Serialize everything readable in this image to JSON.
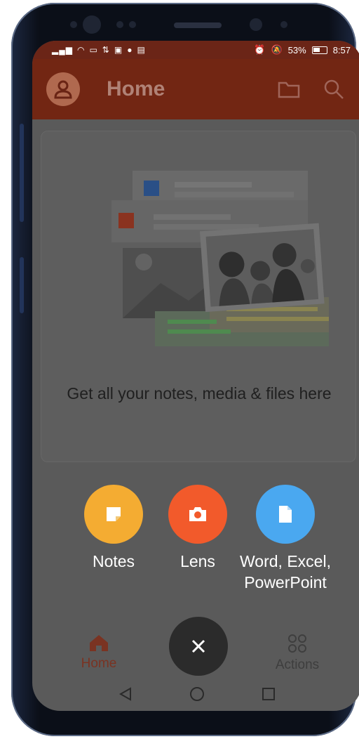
{
  "status_bar": {
    "left_icons": [
      "signal-icon",
      "wifi-icon",
      "cast-icon",
      "sync-icon",
      "linkedin-icon",
      "chat-icon",
      "news-icon"
    ],
    "alarm_icon": "alarm-icon",
    "mute_icon": "bell-off-icon",
    "battery": "53%",
    "time": "8:57"
  },
  "app_bar": {
    "title": "Home",
    "avatar_icon": "person-icon",
    "folder_icon": "folder-icon",
    "search_icon": "search-icon"
  },
  "card": {
    "message": "Get all your notes, media & files here",
    "illustration_icons": [
      "word-doc-icon",
      "powerpoint-doc-icon",
      "image-icon",
      "photo-people-icon"
    ]
  },
  "fab_menu": [
    {
      "label": "Notes",
      "icon": "sticky-note-icon",
      "color": "#f4ac32"
    },
    {
      "label": "Lens",
      "icon": "camera-icon",
      "color": "#f25a2b"
    },
    {
      "label": "Word, Excel,",
      "label2": "PowerPoint",
      "icon": "document-icon",
      "color": "#4aa8f0"
    }
  ],
  "bottom_nav": {
    "home_label": "Home",
    "actions_label": "Actions",
    "close_icon": "close-icon"
  },
  "colors": {
    "accent": "#722613",
    "scrim": "#5a5a5a",
    "close_fab": "#2b2b2b"
  }
}
